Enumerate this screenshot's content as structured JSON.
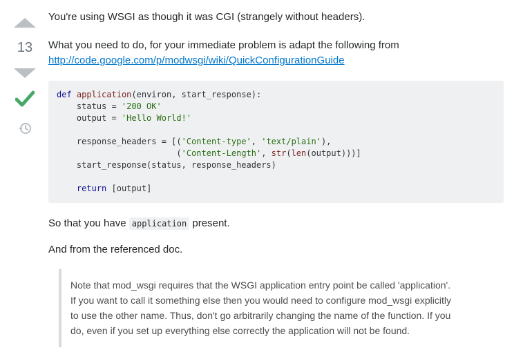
{
  "vote": {
    "score": "13"
  },
  "icons": {
    "upvote": "arrow-up-icon",
    "downvote": "arrow-down-icon",
    "accepted": "checkmark-icon",
    "history": "history-icon"
  },
  "colors": {
    "accepted": "#48a868",
    "vote_arrow": "#bbc0c4",
    "link": "#0077cc",
    "code_bg": "#eff0f1"
  },
  "post": {
    "intro": "You're using WSGI as though it was CGI (strangely without headers).",
    "instruction": "What you need to do, for your immediate problem is adapt the following from",
    "link": "http://code.google.com/p/modwsgi/wiki/QuickConfigurationGuide",
    "code_lines": [
      "def application(environ, start_response):",
      "    status = '200 OK'",
      "    output = 'Hello World!'",
      "",
      "    response_headers = [('Content-type', 'text/plain'),",
      "                        ('Content-Length', str(len(output)))]",
      "    start_response(status, response_headers)",
      "",
      "    return [output]"
    ],
    "so_that_before": "So that you have",
    "so_that_code": "application",
    "so_that_after": "present.",
    "from_doc": "And from the referenced doc.",
    "quote_lines": [
      "Note that mod_wsgi requires that the WSGI application entry point be called 'application'.",
      "If you want to call it something else then you would need to configure mod_wsgi explicitly",
      "to use the other name. Thus, don't go arbitrarily changing the name of the function. If you",
      "do, even if you set up everything else correctly the application will not be found."
    ]
  }
}
